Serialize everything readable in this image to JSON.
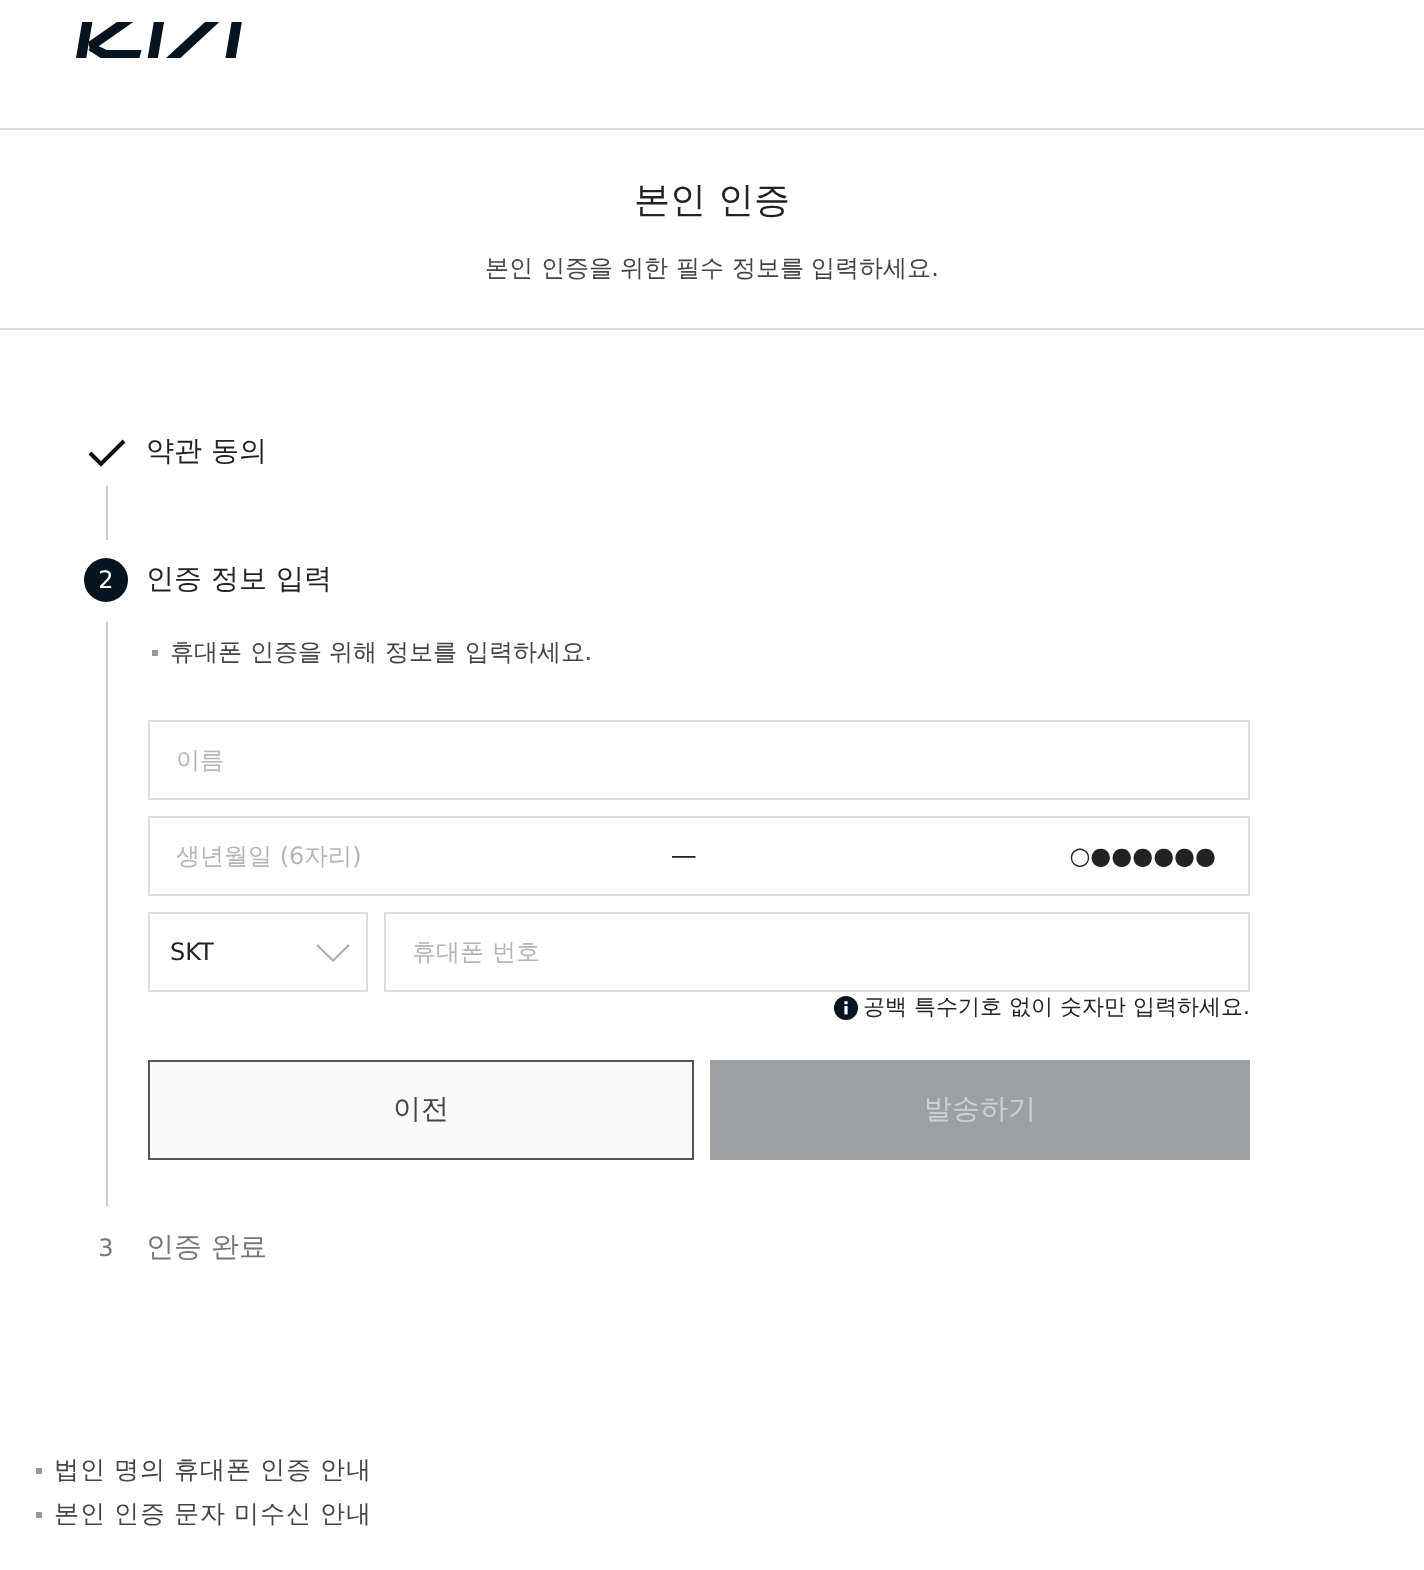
{
  "page_title": "본인 인증",
  "page_subtitle": "본인 인증을 위한 필수 정보를 입력하세요.",
  "steps": [
    {
      "completed": true,
      "current": false,
      "label": "약관 동의"
    },
    {
      "completed": false,
      "current": true,
      "number": "2",
      "label": "인증 정보 입력",
      "guide": "휴대폰 인증을 위해 정보를 입력하세요.",
      "form": {
        "name_field": {
          "placeholder": "이름"
        },
        "birth_field": {
          "placeholder": "생년월일 (6자리)",
          "separator": "—",
          "back_digits": "○●●●●●●"
        },
        "carrier_select": {
          "value": "SKT"
        },
        "phone_field": {
          "placeholder": "휴대폰 번호"
        },
        "hint": "공백 특수기호 없이 숫자만 입력하세요.",
        "buttons": [
          {
            "kind": "secondary",
            "label": "이전",
            "disabled": false
          },
          {
            "kind": "primary",
            "label": "발송하기",
            "disabled": true
          }
        ]
      }
    },
    {
      "completed": false,
      "current": false,
      "number": "3",
      "label": "인증 완료"
    }
  ],
  "footer_links": [
    "법인 명의 휴대폰 인증 안내",
    "본인 인증 문자 미수신 안내"
  ]
}
